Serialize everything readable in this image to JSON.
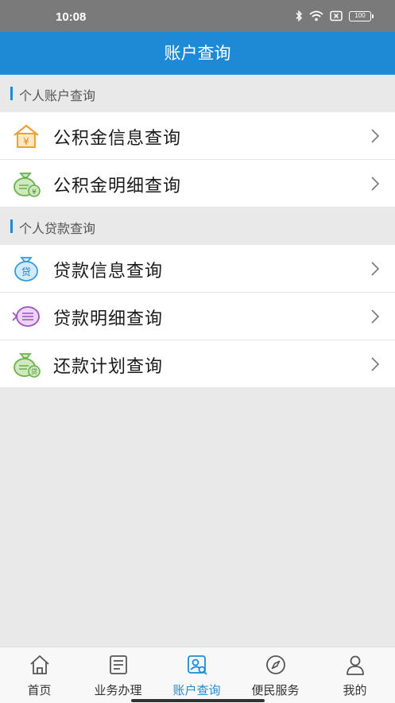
{
  "status_bar": {
    "time": "10:08",
    "battery": "100"
  },
  "header": {
    "title": "账户查询"
  },
  "sections": [
    {
      "title": "个人账户查询",
      "items": [
        {
          "label": "公积金信息查询",
          "icon": "house-yen-icon"
        },
        {
          "label": "公积金明细查询",
          "icon": "money-bag-yen-icon"
        }
      ]
    },
    {
      "title": "个人贷款查询",
      "items": [
        {
          "label": "贷款信息查询",
          "icon": "loan-bag-icon"
        },
        {
          "label": "贷款明细查询",
          "icon": "loan-detail-list-icon"
        },
        {
          "label": "还款计划查询",
          "icon": "repayment-plan-icon"
        }
      ]
    }
  ],
  "nav": [
    {
      "label": "首页",
      "icon": "home-icon",
      "active": false
    },
    {
      "label": "业务办理",
      "icon": "document-icon",
      "active": false
    },
    {
      "label": "账户查询",
      "icon": "account-search-icon",
      "active": true
    },
    {
      "label": "便民服务",
      "icon": "compass-icon",
      "active": false
    },
    {
      "label": "我的",
      "icon": "user-icon",
      "active": false
    }
  ],
  "colors": {
    "primary": "#1e8ad6",
    "background": "#e9e9e9",
    "status_bar": "#7a7a7a"
  }
}
